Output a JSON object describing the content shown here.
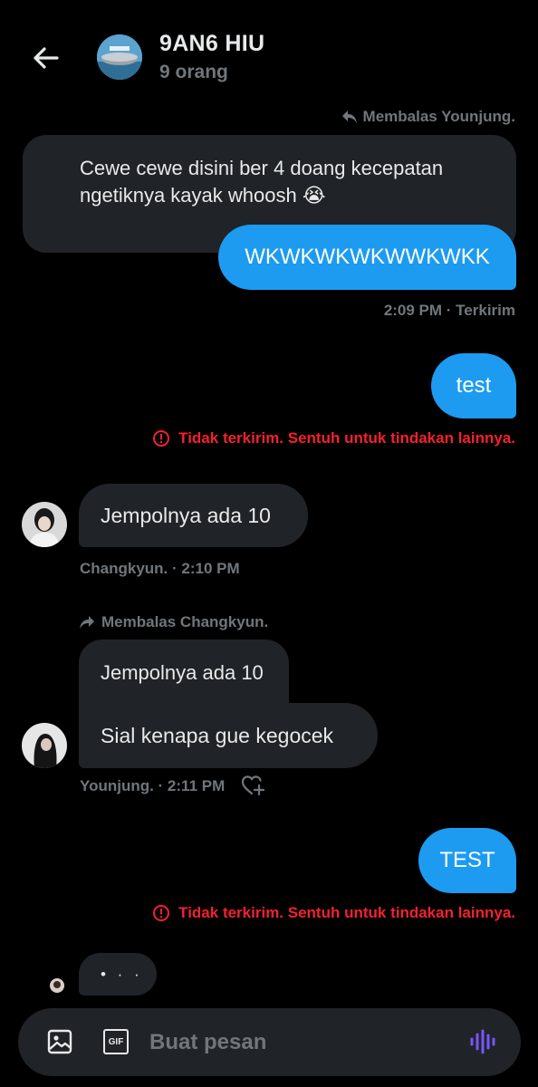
{
  "header": {
    "title": "9AN6 HIU",
    "subtitle": "9 orang",
    "avatar_label": "moaiclan"
  },
  "messages": {
    "reply1_label": "Membalas Younjung.",
    "quoted1": "Cewe cewe disini ber 4 doang kecepatan ngetiknya kayak whoosh 😭",
    "out1": "WKWKWKWKWWKWKK",
    "out1_meta": "2:09 PM · Terkirim",
    "out2": "test",
    "error_text": "Tidak terkirim. Sentuh untuk tindakan lainnya.",
    "in1": "Jempolnya ada 10",
    "in1_meta": "Changkyun. · 2:10 PM",
    "reply2_label": "Membalas Changkyun.",
    "quoted2": "Jempolnya ada 10",
    "in2": "Sial kenapa gue kegocek",
    "in2_meta": "Younjung. · 2:11 PM",
    "out3": "TEST",
    "typing": "• · ·"
  },
  "composer": {
    "placeholder": "Buat pesan",
    "gif_label": "GIF"
  },
  "colors": {
    "accent": "#1d9bf0",
    "error": "#f4212e",
    "muted": "#71767b",
    "bubble_in": "#202327",
    "voice": "#7856ff"
  },
  "icons": [
    "back-arrow-icon",
    "reply-icon",
    "forward-reply-icon",
    "error-circle-icon",
    "heart-plus-icon",
    "image-icon",
    "gif-icon",
    "voice-wave-icon"
  ]
}
